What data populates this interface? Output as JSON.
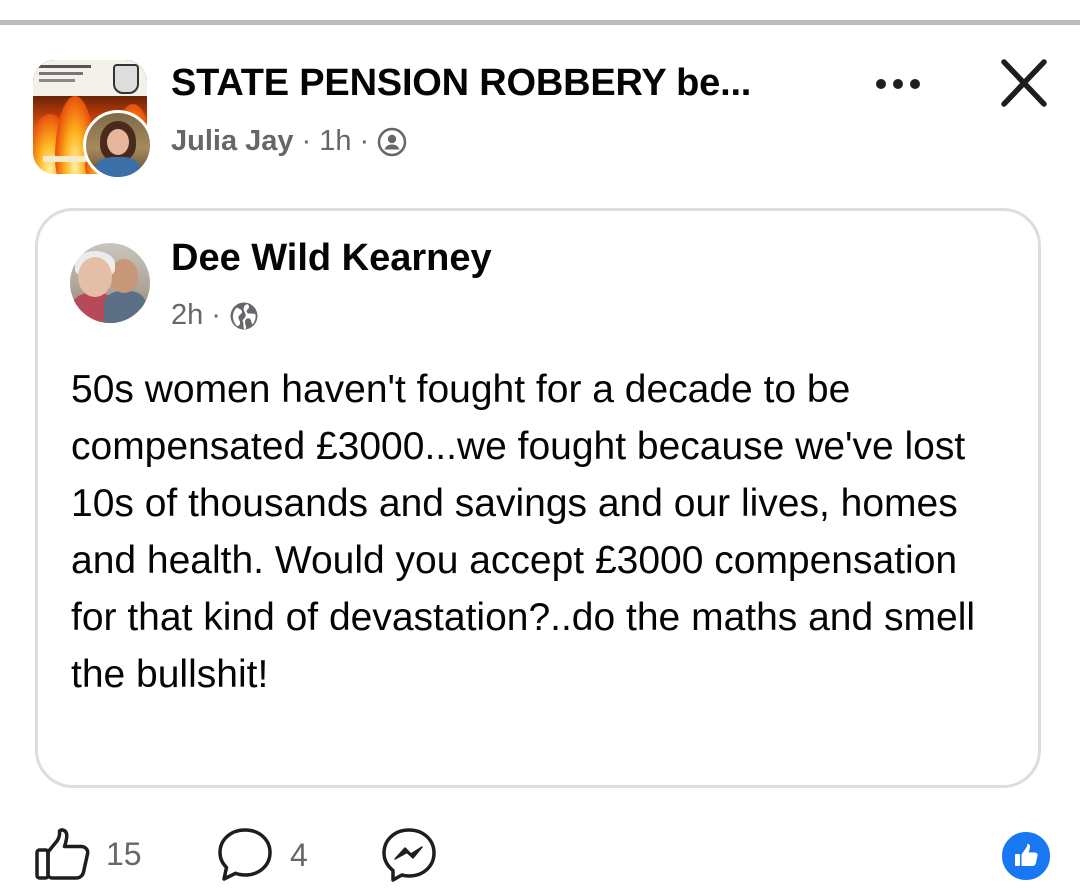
{
  "header": {
    "group_name": "STATE PENSION ROBBERY be...",
    "author": "Julia Jay",
    "time": "1h",
    "privacy_icon": "group-members-icon"
  },
  "shared_post": {
    "author": "Dee Wild Kearney",
    "time": "2h",
    "privacy_icon": "globe-icon",
    "text": "50s women haven't fought for a decade to be compensated £3000...we fought because we've lost 10s of thousands and savings and our lives, homes and health. Would you accept £3000 compensation for that kind of devastation?..do the maths and smell the bullshit!"
  },
  "footer": {
    "like_count": "15",
    "comment_count": "4",
    "share_icon": "messenger-icon",
    "reaction_icon": "like-reaction-icon"
  },
  "colors": {
    "text_primary": "#050505",
    "text_secondary": "#65676b",
    "card_border": "#dadde1",
    "reaction_blue": "#1877f2"
  }
}
